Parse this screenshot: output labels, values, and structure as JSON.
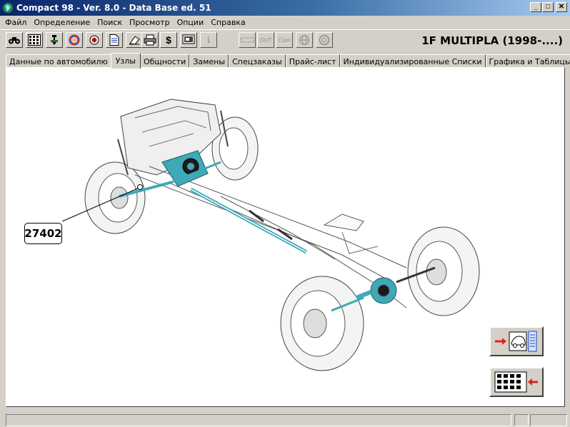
{
  "window": {
    "title": "Compact 98  -  Ver. 8.0  -  Data Base ed. 51",
    "minimize_label": "_",
    "maximize_label": "□",
    "close_label": "✕"
  },
  "menu": [
    {
      "label": "Файл"
    },
    {
      "label": "Определение"
    },
    {
      "label": "Поиск"
    },
    {
      "label": "Просмотр"
    },
    {
      "label": "Опции"
    },
    {
      "label": "Справка"
    }
  ],
  "toolbar": {
    "buttons": [
      {
        "icon": "binoculars-icon"
      },
      {
        "icon": "grid-icon"
      },
      {
        "icon": "parts-tree-icon"
      },
      {
        "icon": "color-wheel-icon"
      },
      {
        "icon": "target-icon"
      },
      {
        "icon": "document-icon"
      },
      {
        "icon": "eraser-icon"
      },
      {
        "icon": "printer-icon"
      },
      {
        "icon": "dollar-icon",
        "label": "$"
      },
      {
        "icon": "screen-icon"
      },
      {
        "icon": "info-icon",
        "label": "i"
      },
      {
        "icon": "in-icon"
      },
      {
        "icon": "out-icon",
        "label": "OUT"
      },
      {
        "icon": "com-icon",
        "label": "Com"
      },
      {
        "icon": "globe-icon"
      },
      {
        "icon": "wheel-icon"
      }
    ]
  },
  "model": {
    "title": "1F MULTIPLA (1998-....)"
  },
  "tabs": [
    {
      "label": "Данные по автомобилю",
      "active": false
    },
    {
      "label": "Узлы",
      "active": true
    },
    {
      "label": "Общности",
      "active": false
    },
    {
      "label": "Замены",
      "active": false
    },
    {
      "label": "Спецзаказы",
      "active": false
    },
    {
      "label": "Прайс-лист",
      "active": false
    },
    {
      "label": "Индивидуализированные Списки",
      "active": false
    },
    {
      "label": "Графика и Таблицы",
      "active": false
    }
  ],
  "diagram": {
    "callout_label": "27402",
    "highlight_color": "#3fa9b8"
  },
  "nav_buttons": [
    {
      "name": "go-to-vehicle-button",
      "icon": "car-list-icon"
    },
    {
      "name": "back-to-groups-button",
      "icon": "groups-grid-icon"
    }
  ]
}
